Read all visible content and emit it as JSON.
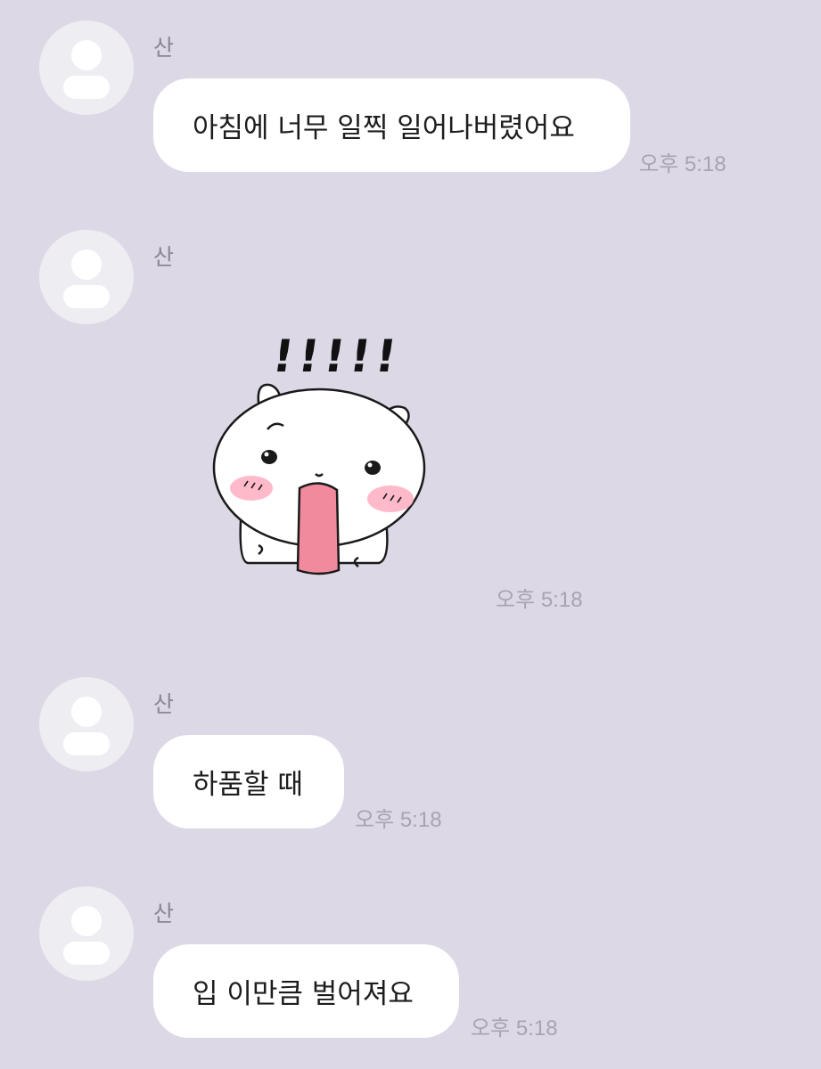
{
  "messages": [
    {
      "sender": "산",
      "text": "아침에 너무 일찍 일어나버렸어요",
      "time": "오후 5:18"
    },
    {
      "sender": "산",
      "sticker": "surprised-yawning-hamster",
      "sticker_text": "!!!!!",
      "time": "오후 5:18"
    },
    {
      "sender": "산",
      "text": "하품할 때",
      "time": "오후 5:18"
    },
    {
      "sender": "산",
      "text": "입 이만큼 벌어져요",
      "time": "오후 5:18"
    }
  ],
  "colors": {
    "background": "#dcd8e6",
    "bubble": "#ffffff",
    "avatar": "#eeedf2",
    "time_text": "#a7a3b0",
    "blush": "#ffb3c4",
    "tongue": "#f28a9e"
  }
}
